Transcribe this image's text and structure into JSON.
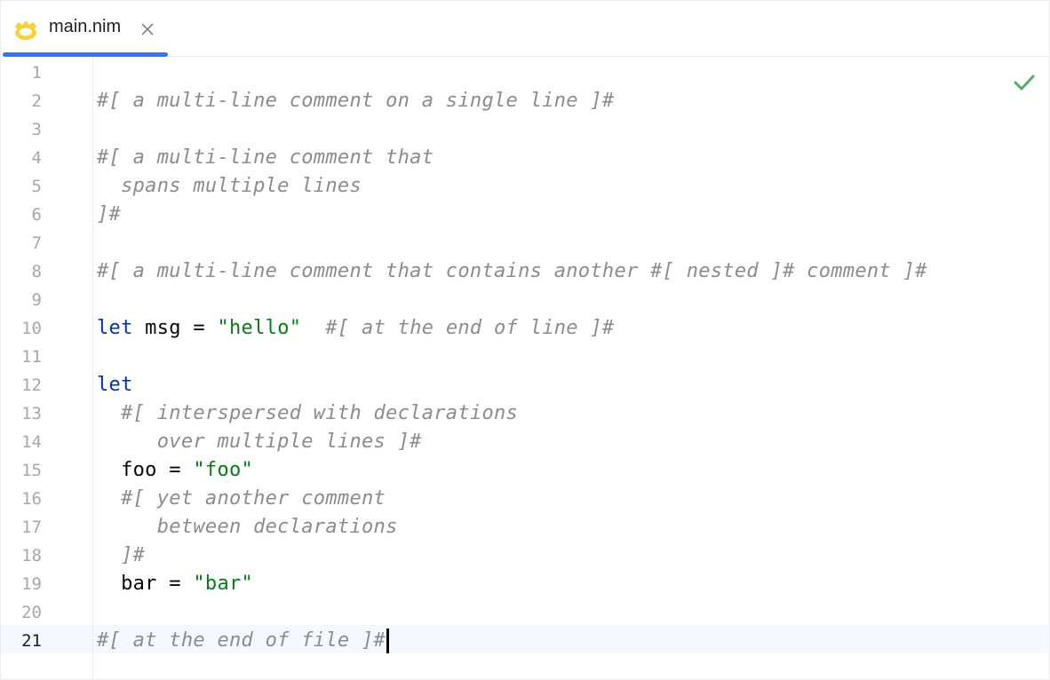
{
  "tab": {
    "filename": "main.nim",
    "icon": "nim-crown-icon",
    "close_icon": "close-icon",
    "accent": "#3574f0"
  },
  "status": {
    "icon": "check-icon",
    "color": "#59a869"
  },
  "colors": {
    "comment": "#8c8c8c",
    "keyword": "#0033b3",
    "string": "#067d17",
    "text": "#080808",
    "line_number": "#a4a7ad",
    "current_line_bg": "#f5f8fe"
  },
  "line_numbers": [
    "1",
    "2",
    "3",
    "4",
    "5",
    "6",
    "7",
    "8",
    "9",
    "10",
    "11",
    "12",
    "13",
    "14",
    "15",
    "16",
    "17",
    "18",
    "19",
    "20",
    "21"
  ],
  "current_line": "21",
  "lines": [
    [],
    [
      {
        "t": "comment",
        "v": "#[ a multi-line comment on a single line ]#"
      }
    ],
    [],
    [
      {
        "t": "comment",
        "v": "#[ a multi-line comment that"
      }
    ],
    [
      {
        "t": "comment",
        "v": "  spans multiple lines"
      }
    ],
    [
      {
        "t": "comment",
        "v": "]#"
      }
    ],
    [],
    [
      {
        "t": "comment",
        "v": "#[ a multi-line comment that contains another #[ nested ]# comment ]#"
      }
    ],
    [],
    [
      {
        "t": "kw",
        "v": "let"
      },
      {
        "t": "plain",
        "v": " msg = "
      },
      {
        "t": "str",
        "v": "\"hello\""
      },
      {
        "t": "plain",
        "v": "  "
      },
      {
        "t": "comment",
        "v": "#[ at the end of line ]#"
      }
    ],
    [],
    [
      {
        "t": "kw",
        "v": "let"
      }
    ],
    [
      {
        "t": "comment",
        "v": "  #[ interspersed with declarations"
      }
    ],
    [
      {
        "t": "comment",
        "v": "     over multiple lines ]#"
      }
    ],
    [
      {
        "t": "plain",
        "v": "  foo = "
      },
      {
        "t": "str",
        "v": "\"foo\""
      }
    ],
    [
      {
        "t": "comment",
        "v": "  #[ yet another comment"
      }
    ],
    [
      {
        "t": "comment",
        "v": "     between declarations"
      }
    ],
    [
      {
        "t": "comment",
        "v": "  ]#"
      }
    ],
    [
      {
        "t": "plain",
        "v": "  bar = "
      },
      {
        "t": "str",
        "v": "\"bar\""
      }
    ],
    [],
    [
      {
        "t": "comment",
        "v": "#[ at the end of file ]#"
      }
    ]
  ]
}
